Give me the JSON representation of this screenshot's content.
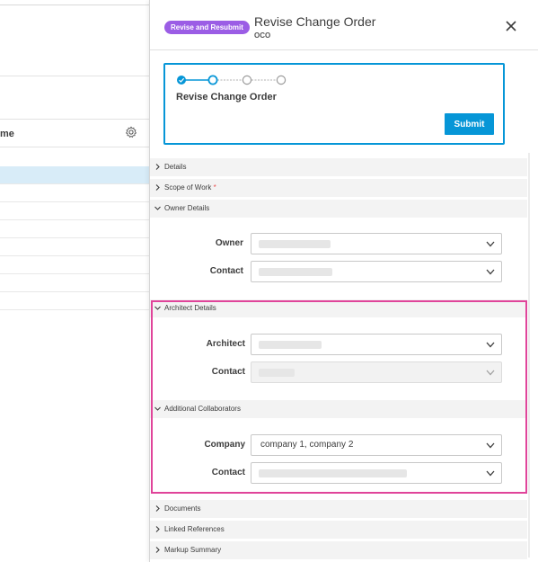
{
  "left_list": {
    "column_header": "me",
    "settings_icon": "gear-icon",
    "rows": 8
  },
  "panel": {
    "badge": "Revise and Resubmit",
    "title": "Revise Change Order",
    "subtitle": "OCO",
    "close_icon": "close-icon",
    "workflow": {
      "title": "Revise Change Order",
      "steps": 4,
      "current_step": 2,
      "submit_label": "Submit"
    },
    "sections": {
      "details": "Details",
      "scope": "Scope of Work",
      "scope_required": "*",
      "owner": "Owner Details",
      "architect": "Architect Details",
      "collaborators": "Additional Collaborators",
      "documents": "Documents",
      "linked": "Linked References",
      "markup": "Markup Summary"
    },
    "owner": {
      "owner_label": "Owner",
      "contact_label": "Contact"
    },
    "architect": {
      "architect_label": "Architect",
      "contact_label": "Contact"
    },
    "collaborators": {
      "company_label": "Company",
      "company_value": "company 1, company 2",
      "contact_label": "Contact"
    }
  },
  "colors": {
    "accent": "#0696d7",
    "badge": "#9b5de5",
    "highlight": "#e0449a"
  }
}
